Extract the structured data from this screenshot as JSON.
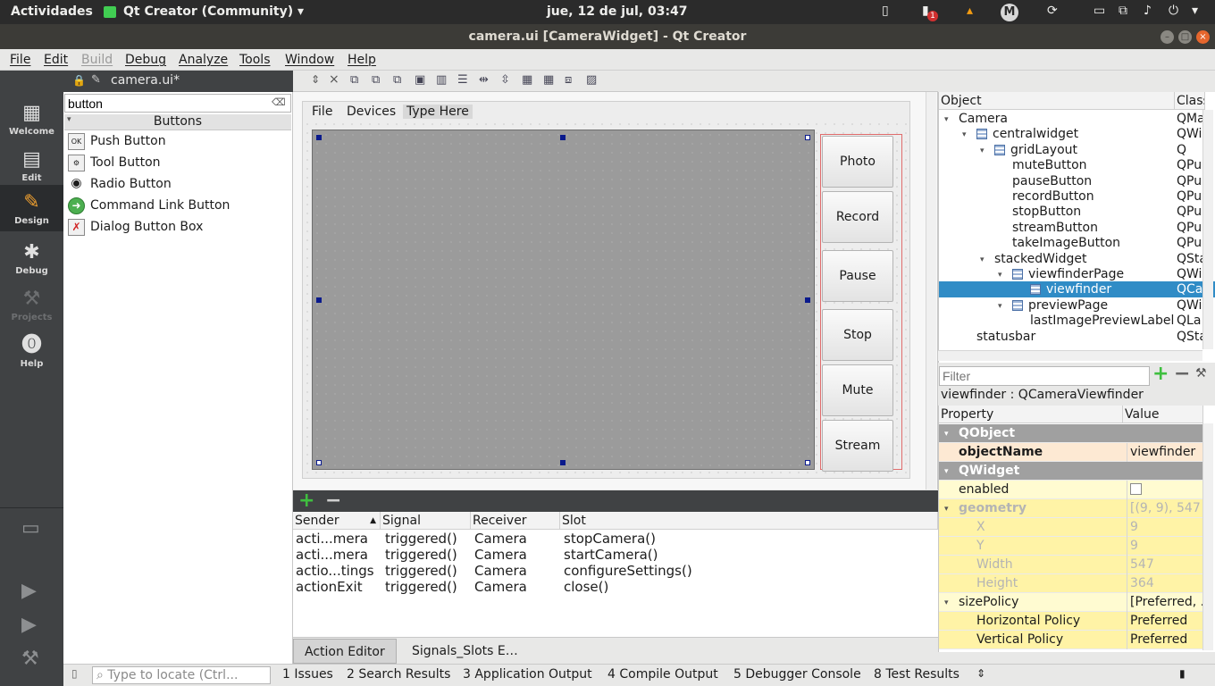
{
  "topbar": {
    "activities": "Actividades",
    "app_name": "Qt Creator (Community)",
    "app_arrow": "▾",
    "clock": "jue, 12 de jul, 03:47",
    "notif_badge": "1",
    "avatar_letter": "M",
    "power_arrow": "▾"
  },
  "window": {
    "title": "camera.ui [CameraWidget] - Qt Creator"
  },
  "menubar": {
    "items": [
      "File",
      "Edit",
      "Build",
      "Debug",
      "Analyze",
      "Tools",
      "Window",
      "Help"
    ]
  },
  "modes": [
    {
      "label": "Welcome",
      "icon": "grid-icon"
    },
    {
      "label": "Edit",
      "icon": "document-icon"
    },
    {
      "label": "Design",
      "icon": "pencil-icon"
    },
    {
      "label": "Debug",
      "icon": "bug-icon"
    },
    {
      "label": "Projects",
      "icon": "wrench-icon"
    },
    {
      "label": "Help",
      "icon": "help-icon"
    }
  ],
  "document": {
    "tab": "camera.ui*"
  },
  "widgetbox": {
    "search_value": "button",
    "category": "Buttons",
    "items": [
      {
        "label": "Push Button",
        "icon": "push-button-icon"
      },
      {
        "label": "Tool Button",
        "icon": "tool-button-icon"
      },
      {
        "label": "Radio Button",
        "icon": "radio-button-icon"
      },
      {
        "label": "Command Link Button",
        "icon": "command-link-icon"
      },
      {
        "label": "Dialog Button Box",
        "icon": "dialog-button-box-icon"
      }
    ]
  },
  "form": {
    "menu": [
      "File",
      "Devices",
      "Type Here"
    ],
    "buttons": [
      "Photo",
      "Record",
      "Pause",
      "Stop",
      "Mute",
      "Stream"
    ]
  },
  "action_editor": {
    "columns": [
      "Sender",
      "Signal",
      "Receiver",
      "Slot"
    ],
    "rows": [
      [
        "acti...mera",
        "triggered()",
        "Camera",
        "stopCamera()"
      ],
      [
        "acti...mera",
        "triggered()",
        "Camera",
        "startCamera()"
      ],
      [
        "actio...tings",
        "triggered()",
        "Camera",
        "configureSettings()"
      ],
      [
        "actionExit",
        "triggered()",
        "Camera",
        "close()"
      ]
    ],
    "tabs": [
      "Action Editor",
      "Signals_Slots E…"
    ]
  },
  "object_inspector": {
    "columns": [
      "Object",
      "Class"
    ],
    "rows": [
      {
        "name": "Camera",
        "class": "QMa",
        "indent": 0,
        "twisty": "▾",
        "grid": false
      },
      {
        "name": "centralwidget",
        "class": "QWi",
        "indent": 1,
        "twisty": "▾",
        "grid": true
      },
      {
        "name": "gridLayout",
        "class": "Q",
        "indent": 2,
        "twisty": "▾",
        "grid": true
      },
      {
        "name": "muteButton",
        "class": "QPu",
        "indent": 3,
        "twisty": "",
        "grid": false
      },
      {
        "name": "pauseButton",
        "class": "QPu",
        "indent": 3,
        "twisty": "",
        "grid": false
      },
      {
        "name": "recordButton",
        "class": "QPu",
        "indent": 3,
        "twisty": "",
        "grid": false
      },
      {
        "name": "stopButton",
        "class": "QPu",
        "indent": 3,
        "twisty": "",
        "grid": false
      },
      {
        "name": "streamButton",
        "class": "QPu",
        "indent": 3,
        "twisty": "",
        "grid": false
      },
      {
        "name": "takeImageButton",
        "class": "QPu",
        "indent": 3,
        "twisty": "",
        "grid": false
      },
      {
        "name": "stackedWidget",
        "class": "QSta",
        "indent": 2,
        "twisty": "▾",
        "grid": false
      },
      {
        "name": "viewfinderPage",
        "class": "QWi",
        "indent": 3,
        "twisty": "▾",
        "grid": true
      },
      {
        "name": "viewfinder",
        "class": "QCa",
        "indent": 4,
        "twisty": "",
        "grid": true,
        "selected": true
      },
      {
        "name": "previewPage",
        "class": "QWi",
        "indent": 3,
        "twisty": "▾",
        "grid": true
      },
      {
        "name": "lastImagePreviewLabel",
        "class": "QLa",
        "indent": 4,
        "twisty": "",
        "grid": false
      },
      {
        "name": "statusbar",
        "class": "QSta",
        "indent": 1,
        "twisty": "",
        "grid": false
      }
    ],
    "filter_placeholder": "Filter"
  },
  "property_editor": {
    "caption": "viewfinder : QCameraViewfinder",
    "columns": [
      "Property",
      "Value"
    ],
    "rows": [
      {
        "name": "QObject",
        "value": "",
        "type": "grp",
        "twisty": "▾"
      },
      {
        "name": "objectName",
        "value": "viewfinder",
        "type": "o",
        "bold": true
      },
      {
        "name": "QWidget",
        "value": "",
        "type": "grp",
        "twisty": "▾"
      },
      {
        "name": "enabled",
        "value": "",
        "type": "y",
        "checkbox": true
      },
      {
        "name": "geometry",
        "value": "[(9, 9), 547 ...",
        "type": "y2",
        "dis": true,
        "twisty": "▾",
        "bold": true
      },
      {
        "name": "X",
        "value": "9",
        "type": "y2",
        "dis": true,
        "sub": true
      },
      {
        "name": "Y",
        "value": "9",
        "type": "y2",
        "dis": true,
        "sub": true
      },
      {
        "name": "Width",
        "value": "547",
        "type": "y2",
        "dis": true,
        "sub": true
      },
      {
        "name": "Height",
        "value": "364",
        "type": "y2",
        "dis": true,
        "sub": true
      },
      {
        "name": "sizePolicy",
        "value": "[Preferred, ...",
        "type": "y",
        "twisty": "▾"
      },
      {
        "name": "Horizontal Policy",
        "value": "Preferred",
        "type": "y2",
        "sub": true
      },
      {
        "name": "Vertical Policy",
        "value": "Preferred",
        "type": "y2",
        "sub": true
      }
    ]
  },
  "statusbar": {
    "locate_placeholder": "Type to locate (Ctrl...",
    "tabs": [
      "1  Issues",
      "2  Search Results",
      "3  Application Output",
      "4  Compile Output",
      "5  Debugger Console",
      "8  Test Results"
    ]
  }
}
